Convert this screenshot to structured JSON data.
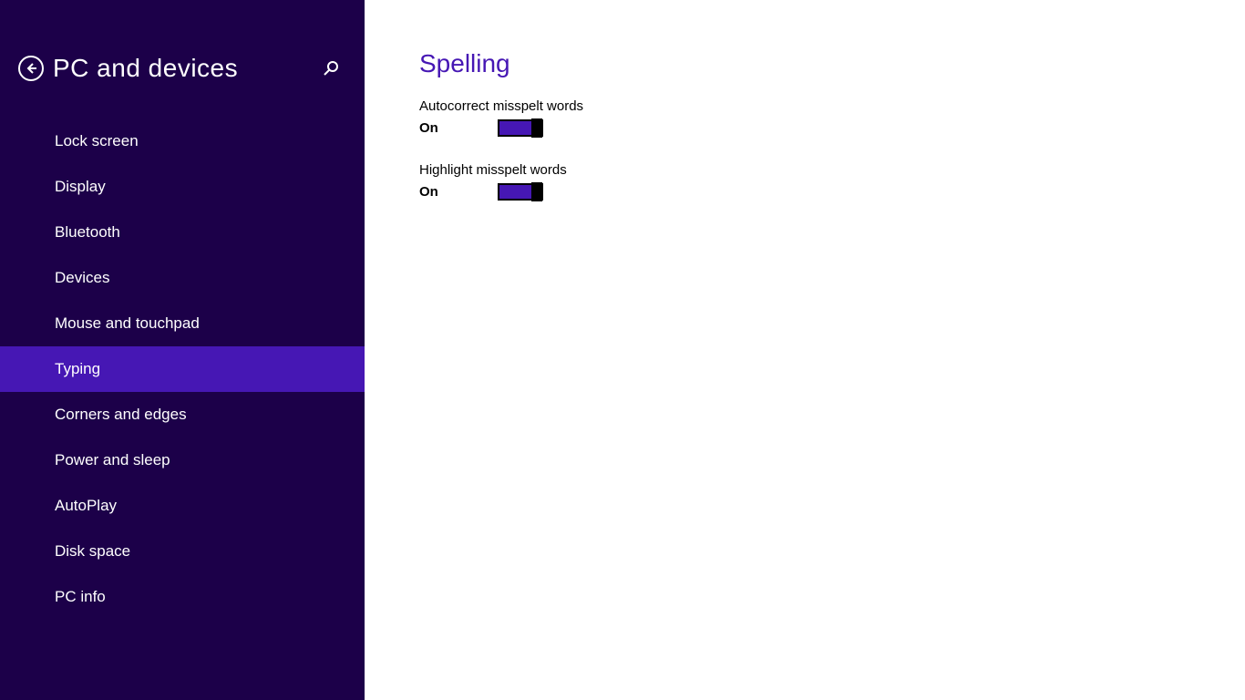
{
  "sidebar": {
    "title": "PC and devices",
    "items": [
      {
        "label": "Lock screen",
        "selected": false
      },
      {
        "label": "Display",
        "selected": false
      },
      {
        "label": "Bluetooth",
        "selected": false
      },
      {
        "label": "Devices",
        "selected": false
      },
      {
        "label": "Mouse and touchpad",
        "selected": false
      },
      {
        "label": "Typing",
        "selected": true
      },
      {
        "label": "Corners and edges",
        "selected": false
      },
      {
        "label": "Power and sleep",
        "selected": false
      },
      {
        "label": "AutoPlay",
        "selected": false
      },
      {
        "label": "Disk space",
        "selected": false
      },
      {
        "label": "PC info",
        "selected": false
      }
    ]
  },
  "content": {
    "section_title": "Spelling",
    "settings": [
      {
        "label": "Autocorrect misspelt words",
        "state": "On",
        "on": true
      },
      {
        "label": "Highlight misspelt words",
        "state": "On",
        "on": true
      }
    ]
  },
  "colors": {
    "sidebar_bg": "#1c0049",
    "accent": "#4617b4"
  }
}
